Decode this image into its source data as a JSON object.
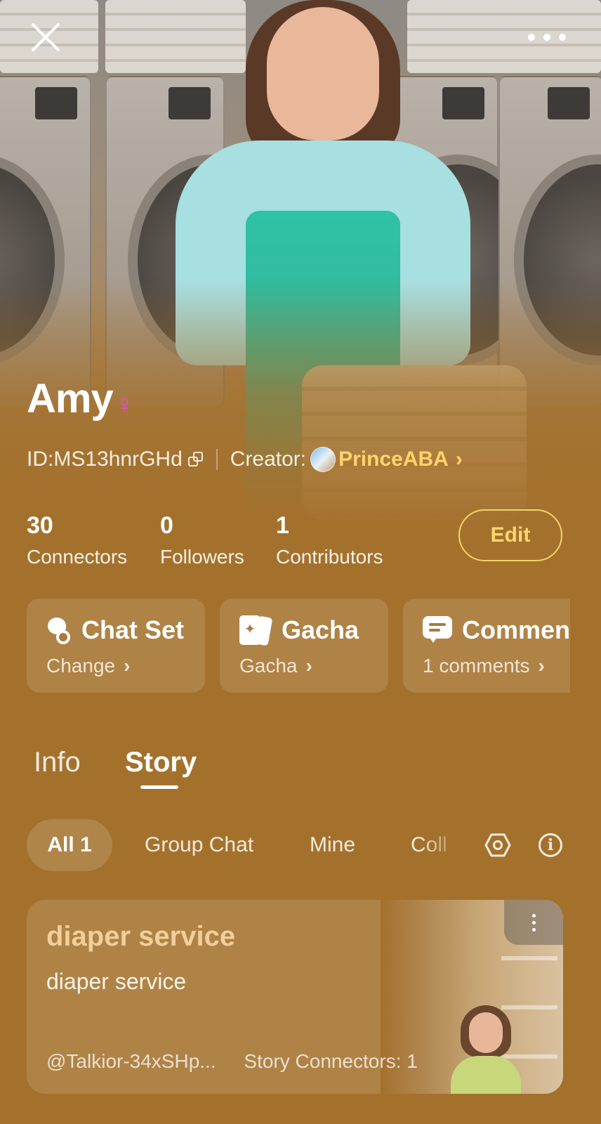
{
  "profile": {
    "name": "Amy",
    "gender_symbol": "♀",
    "id_text": "ID:MS13hnrGHd",
    "creator_label": "Creator:",
    "creator_name": "PrinceABA",
    "creator_chevron": "›"
  },
  "stats": [
    {
      "value": "30",
      "label": "Connectors"
    },
    {
      "value": "0",
      "label": "Followers"
    },
    {
      "value": "1",
      "label": "Contributors"
    }
  ],
  "edit_label": "Edit",
  "cards": [
    {
      "icon": "chat-set-icon",
      "title": "Chat Set",
      "subtitle": "Change"
    },
    {
      "icon": "gacha-icon",
      "title": "Gacha",
      "subtitle": "Gacha"
    },
    {
      "icon": "comment-icon",
      "title": "Commen",
      "subtitle": "1 comments"
    }
  ],
  "card_chevron": "›",
  "tabs": [
    {
      "label": "Info",
      "active": false
    },
    {
      "label": "Story",
      "active": true
    }
  ],
  "filters": [
    {
      "label": "All 1",
      "active": true
    },
    {
      "label": "Group Chat",
      "active": false
    },
    {
      "label": "Mine",
      "active": false
    },
    {
      "label": "Coll",
      "active": false
    }
  ],
  "info_glyph": "i",
  "story": {
    "title": "diaper service",
    "description": "diaper service",
    "author": "@Talkior-34xSHp...",
    "connectors": "Story Connectors: 1"
  },
  "colors": {
    "background": "#a4712d",
    "accent_gold": "#ffd46b",
    "gender_pink": "#e64bd8",
    "story_title": "#f2cf9a"
  }
}
